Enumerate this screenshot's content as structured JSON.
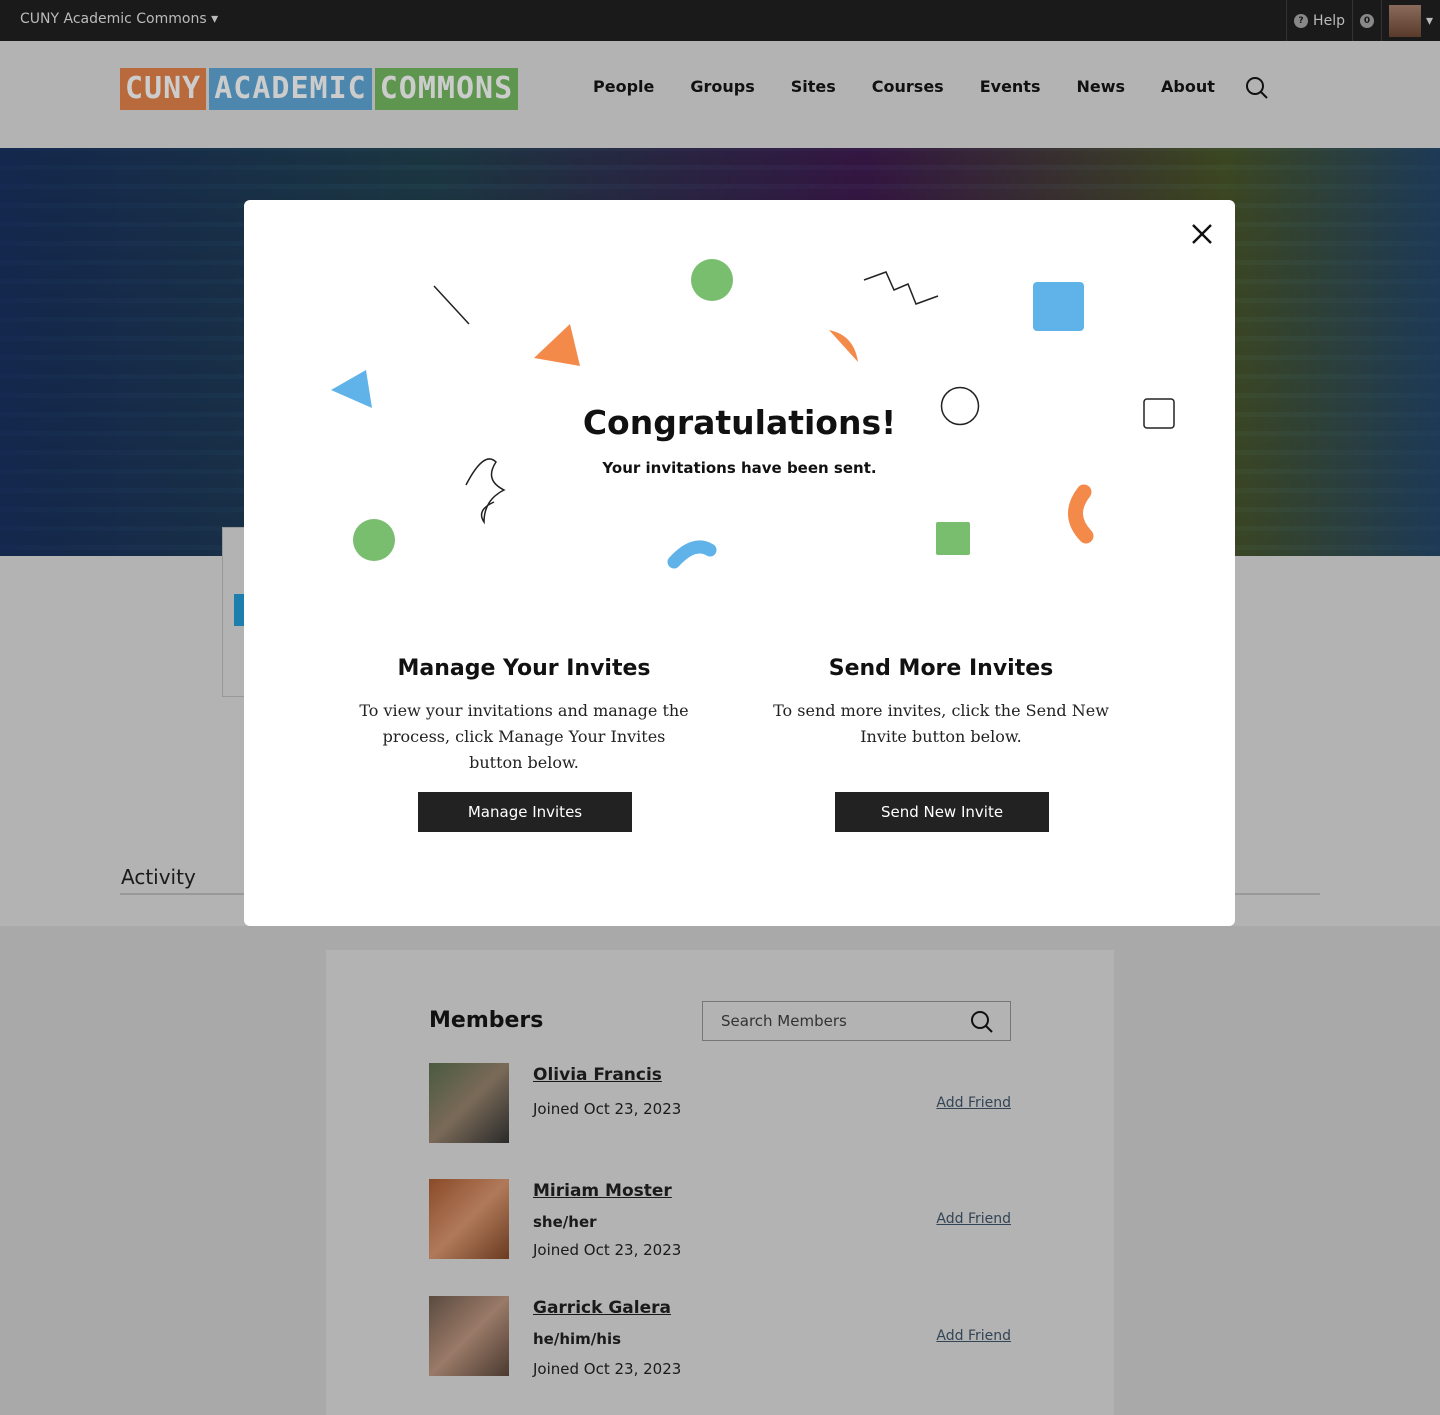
{
  "topbar": {
    "site": "CUNY Academic Commons",
    "help": "Help",
    "notifications": "0"
  },
  "logo": [
    "CUNY",
    "ACADEMIC",
    "COMMONS"
  ],
  "nav": [
    "People",
    "Groups",
    "Sites",
    "Courses",
    "Events",
    "News",
    "About"
  ],
  "page": {
    "activity": "Activity"
  },
  "modal": {
    "title": "Congratulations!",
    "subtitle": "Your invitations have been sent.",
    "manage": {
      "heading": "Manage Your Invites",
      "text": "To view your invitations and manage the process, click Manage Your Invites button below.",
      "button": "Manage Invites"
    },
    "send": {
      "heading": "Send More Invites",
      "text": "To send more invites, click the Send New Invite button below.",
      "button": "Send New Invite"
    }
  },
  "members": {
    "title": "Members",
    "search_placeholder": "Search Members",
    "add_friend": "Add Friend",
    "list": [
      {
        "name": "Olivia Francis",
        "pronouns": "",
        "joined": "Joined Oct 23, 2023"
      },
      {
        "name": "Miriam Moster",
        "pronouns": "she/her",
        "joined": "Joined Oct 23, 2023"
      },
      {
        "name": "Garrick Galera",
        "pronouns": "he/him/his",
        "joined": "Joined Oct 23, 2023"
      }
    ]
  },
  "colors": {
    "orange": "#f38a4a",
    "blue": "#5fb3e8",
    "green": "#79bd6e",
    "logo_orange": "#b86a3c",
    "logo_blue": "#4d87ad",
    "logo_green": "#5e9650"
  }
}
